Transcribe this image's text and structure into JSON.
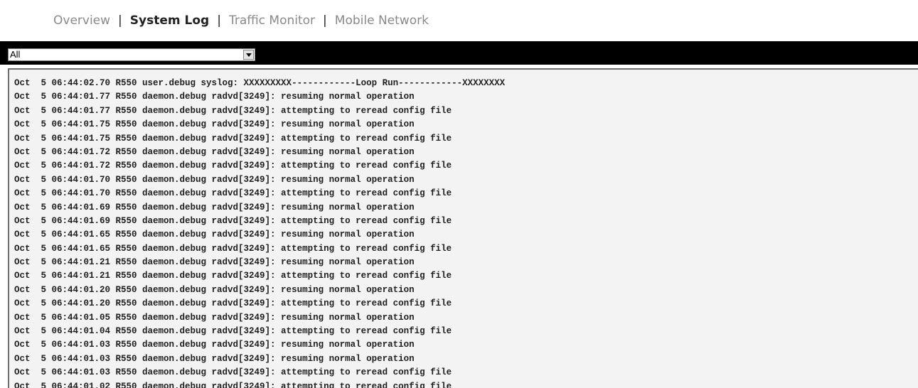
{
  "tabs": [
    {
      "label": "Overview",
      "active": false
    },
    {
      "label": "System Log",
      "active": true
    },
    {
      "label": "Traffic Monitor",
      "active": false
    },
    {
      "label": "Mobile Network",
      "active": false
    }
  ],
  "separator": "|",
  "filter": {
    "selected": "All"
  },
  "log_lines": [
    "Oct  5 06:44:02.70 R550 user.debug syslog: XXXXXXXXX------------Loop Run------------XXXXXXXX",
    "Oct  5 06:44:01.77 R550 daemon.debug radvd[3249]: resuming normal operation",
    "Oct  5 06:44:01.77 R550 daemon.debug radvd[3249]: attempting to reread config file",
    "Oct  5 06:44:01.75 R550 daemon.debug radvd[3249]: resuming normal operation",
    "Oct  5 06:44:01.75 R550 daemon.debug radvd[3249]: attempting to reread config file",
    "Oct  5 06:44:01.72 R550 daemon.debug radvd[3249]: resuming normal operation",
    "Oct  5 06:44:01.72 R550 daemon.debug radvd[3249]: attempting to reread config file",
    "Oct  5 06:44:01.70 R550 daemon.debug radvd[3249]: resuming normal operation",
    "Oct  5 06:44:01.70 R550 daemon.debug radvd[3249]: attempting to reread config file",
    "Oct  5 06:44:01.69 R550 daemon.debug radvd[3249]: resuming normal operation",
    "Oct  5 06:44:01.69 R550 daemon.debug radvd[3249]: attempting to reread config file",
    "Oct  5 06:44:01.65 R550 daemon.debug radvd[3249]: resuming normal operation",
    "Oct  5 06:44:01.65 R550 daemon.debug radvd[3249]: attempting to reread config file",
    "Oct  5 06:44:01.21 R550 daemon.debug radvd[3249]: resuming normal operation",
    "Oct  5 06:44:01.21 R550 daemon.debug radvd[3249]: attempting to reread config file",
    "Oct  5 06:44:01.20 R550 daemon.debug radvd[3249]: resuming normal operation",
    "Oct  5 06:44:01.20 R550 daemon.debug radvd[3249]: attempting to reread config file",
    "Oct  5 06:44:01.05 R550 daemon.debug radvd[3249]: resuming normal operation",
    "Oct  5 06:44:01.04 R550 daemon.debug radvd[3249]: attempting to reread config file",
    "Oct  5 06:44:01.03 R550 daemon.debug radvd[3249]: resuming normal operation",
    "Oct  5 06:44:01.03 R550 daemon.debug radvd[3249]: resuming normal operation",
    "Oct  5 06:44:01.03 R550 daemon.debug radvd[3249]: attempting to reread config file",
    "Oct  5 06:44:01.02 R550 daemon.debug radvd[3249]: attempting to reread config file"
  ]
}
